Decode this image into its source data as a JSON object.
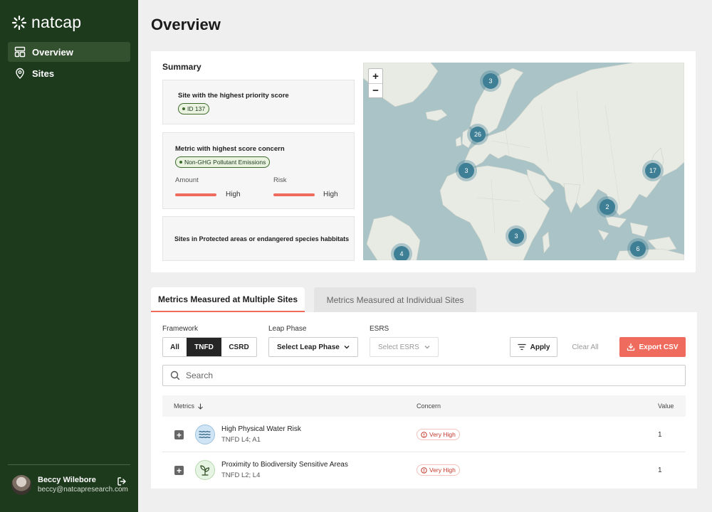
{
  "app": {
    "brand": "natcap",
    "accent": "#ee6b5d",
    "sidebar_color": "#1d3a1c"
  },
  "sidebar": {
    "items": [
      {
        "label": "Overview",
        "icon": "layout-icon",
        "active": true
      },
      {
        "label": "Sites",
        "icon": "map-pin-icon",
        "active": false
      }
    ],
    "user": {
      "name": "Beccy Wilebore",
      "email": "beccy@natcapresearch.com"
    }
  },
  "page": {
    "title": "Overview"
  },
  "summary": {
    "title": "Summary",
    "highest_priority": {
      "label": "Site with the highest priority score",
      "badge": "ID 137"
    },
    "highest_concern": {
      "label": "Metric with highest score concern",
      "badge": "Non-GHG Pollutant Emissions",
      "amount_label": "Amount",
      "amount_value": "High",
      "risk_label": "Risk",
      "risk_value": "High"
    },
    "protected": {
      "label": "Sites in Protected areas or endangered species habbitats"
    }
  },
  "map": {
    "zoom_in": "+",
    "zoom_out": "−",
    "clusters": [
      "3",
      "26",
      "3",
      "17",
      "2",
      "3",
      "4",
      "6"
    ]
  },
  "tabs": [
    {
      "label": "Metrics Measured at Multiple Sites",
      "active": true
    },
    {
      "label": "Metrics Measured at Individual Sites",
      "active": false
    }
  ],
  "filters": {
    "framework_label": "Framework",
    "framework_options": [
      "All",
      "TNFD",
      "CSRD"
    ],
    "framework_selected": "TNFD",
    "leap_label": "Leap Phase",
    "leap_value": "Select Leap Phase",
    "esrs_label": "ESRS",
    "esrs_value": "Select ESRS",
    "apply": "Apply",
    "clear": "Clear All",
    "export": "Export CSV"
  },
  "search": {
    "placeholder": "Search"
  },
  "table": {
    "headers": {
      "metrics": "Metrics",
      "concern": "Concern",
      "value": "Value"
    },
    "rows": [
      {
        "name": "High Physical Water Risk",
        "sub": "TNFD L4; A1",
        "concern": "Very High",
        "value": "1",
        "icon": "water-waves-icon"
      },
      {
        "name": "Proximity to Biodiversity Sensitive Areas",
        "sub": "TNFD L2; L4",
        "concern": "Very High",
        "value": "1",
        "icon": "plant-icon"
      }
    ]
  }
}
